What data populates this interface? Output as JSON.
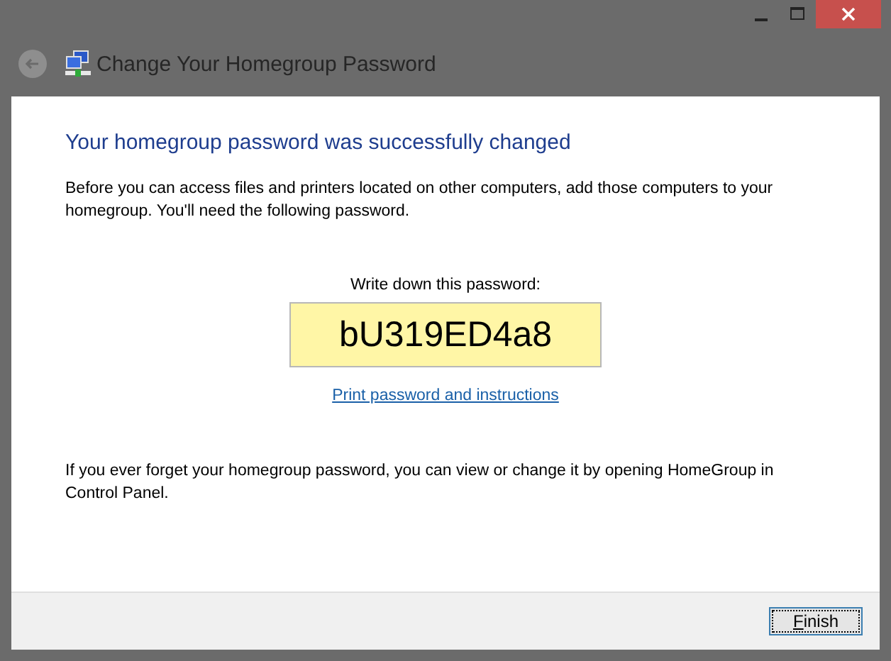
{
  "window": {
    "title": "Change Your Homegroup Password",
    "controls": [
      {
        "kind": "minimize"
      },
      {
        "kind": "maximize"
      },
      {
        "kind": "close"
      }
    ]
  },
  "heading": "Your homegroup password was successfully changed",
  "intro": "Before you can access files and printers located on other computers, add those computers to your homegroup. You'll need the following password.",
  "password_label": "Write down this password:",
  "password": "bU319ED4a8",
  "print_link": "Print password and instructions",
  "note": "If you ever forget your homegroup password, you can view or change it by opening HomeGroup in Control Panel.",
  "buttons": [
    {
      "label": "Finish",
      "focused": true
    }
  ]
}
